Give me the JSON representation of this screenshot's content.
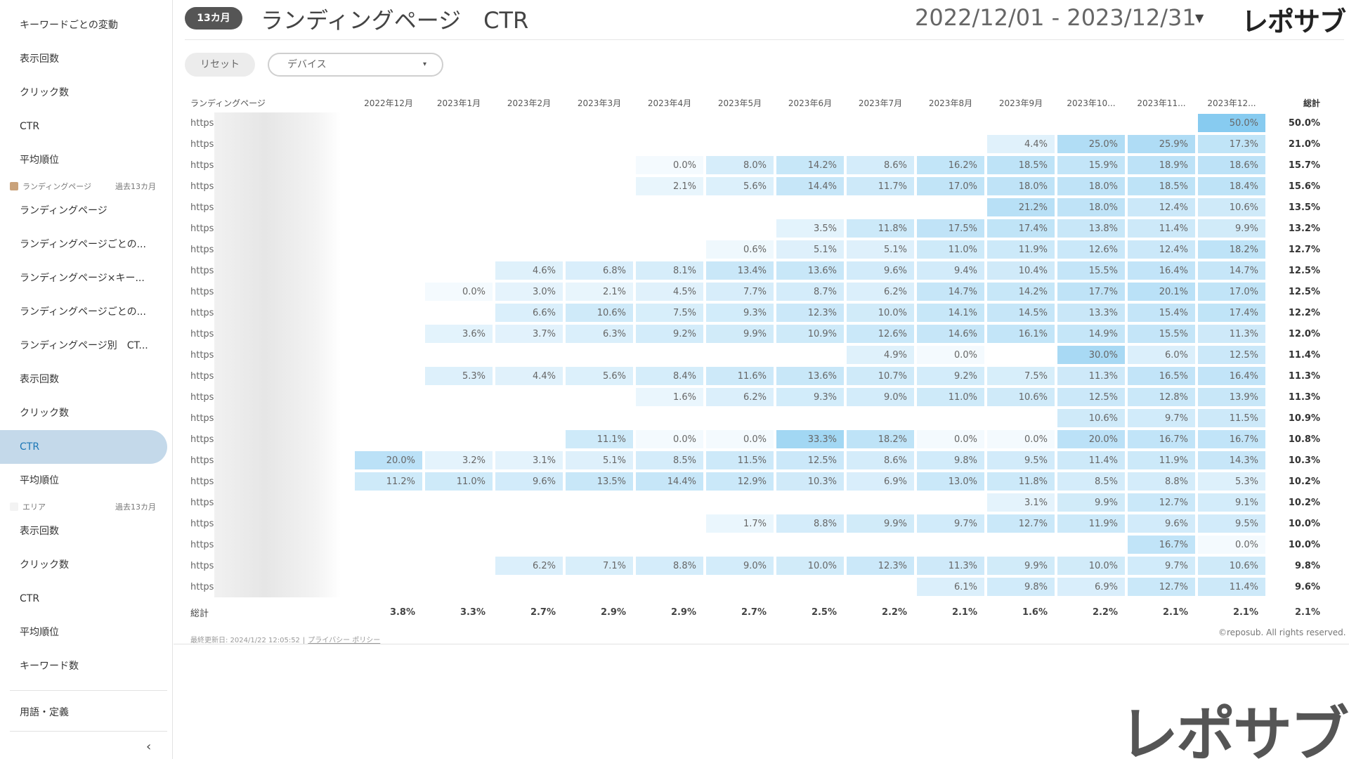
{
  "sidebar": {
    "items_top": [
      {
        "label": "キーワードごとの変動"
      },
      {
        "label": "表示回数"
      },
      {
        "label": "クリック数"
      },
      {
        "label": "CTR"
      },
      {
        "label": "平均順位"
      }
    ],
    "section_lp": {
      "label": "ランディングページ",
      "period": "過去13カ月"
    },
    "items_lp": [
      {
        "label": "ランディングページ"
      },
      {
        "label": "ランディングページごとの..."
      },
      {
        "label": "ランディングページ×キー..."
      },
      {
        "label": "ランディングページごとの..."
      },
      {
        "label": "ランディングページ別　CT..."
      },
      {
        "label": "表示回数"
      },
      {
        "label": "クリック数"
      },
      {
        "label": "CTR"
      },
      {
        "label": "平均順位"
      }
    ],
    "section_area": {
      "label": "エリア",
      "period": "過去13カ月"
    },
    "items_area": [
      {
        "label": "表示回数"
      },
      {
        "label": "クリック数"
      },
      {
        "label": "CTR"
      },
      {
        "label": "平均順位"
      },
      {
        "label": "キーワード数"
      }
    ],
    "glossary": "用語・定義",
    "collapse_icon": "‹"
  },
  "header": {
    "badge": "13カ月",
    "title": "ランディングページ　CTR",
    "date_range": "2022/12/01 - 2023/12/31",
    "caret": "▼",
    "brand": "レポサブ"
  },
  "filters": {
    "reset_label": "リセット",
    "device_label": "デバイス",
    "caret": "▾"
  },
  "table": {
    "lp_header": "ランディングページ",
    "total_header": "総計",
    "months": [
      "2022年12月",
      "2023年1月",
      "2023年2月",
      "2023年3月",
      "2023年4月",
      "2023年5月",
      "2023年6月",
      "2023年7月",
      "2023年8月",
      "2023年9月",
      "2023年10...",
      "2023年11...",
      "2023年12..."
    ],
    "rows": [
      {
        "lp": "https:/",
        "values": [
          null,
          null,
          null,
          null,
          null,
          null,
          null,
          null,
          null,
          null,
          null,
          null,
          50.0
        ],
        "total": "50.0%"
      },
      {
        "lp": "https:/",
        "values": [
          null,
          null,
          null,
          null,
          null,
          null,
          null,
          null,
          null,
          4.4,
          25.0,
          25.9,
          17.3
        ],
        "total": "21.0%"
      },
      {
        "lp": "https:/",
        "values": [
          null,
          null,
          null,
          null,
          0.0,
          8.0,
          14.2,
          8.6,
          16.2,
          18.5,
          15.9,
          18.9,
          18.6
        ],
        "total": "15.7%"
      },
      {
        "lp": "https:/",
        "values": [
          null,
          null,
          null,
          null,
          2.1,
          5.6,
          14.4,
          11.7,
          17.0,
          18.0,
          18.0,
          18.5,
          18.4
        ],
        "total": "15.6%"
      },
      {
        "lp": "https:/",
        "values": [
          null,
          null,
          null,
          null,
          null,
          null,
          null,
          null,
          null,
          21.2,
          18.0,
          12.4,
          10.6
        ],
        "total": "13.5%"
      },
      {
        "lp": "https:/",
        "values": [
          null,
          null,
          null,
          null,
          null,
          null,
          3.5,
          11.8,
          17.5,
          17.4,
          13.8,
          11.4,
          9.9
        ],
        "total": "13.2%"
      },
      {
        "lp": "https:/",
        "values": [
          null,
          null,
          null,
          null,
          null,
          0.6,
          5.1,
          5.1,
          11.0,
          11.9,
          12.6,
          12.4,
          18.2
        ],
        "total": "12.7%"
      },
      {
        "lp": "https:/",
        "values": [
          null,
          null,
          4.6,
          6.8,
          8.1,
          13.4,
          13.6,
          9.6,
          9.4,
          10.4,
          15.5,
          16.4,
          14.7
        ],
        "total": "12.5%"
      },
      {
        "lp": "https:/",
        "values": [
          null,
          0.0,
          3.0,
          2.1,
          4.5,
          7.7,
          8.7,
          6.2,
          14.7,
          14.2,
          17.7,
          20.1,
          17.0
        ],
        "total": "12.5%"
      },
      {
        "lp": "https:/",
        "values": [
          null,
          null,
          6.6,
          10.6,
          7.5,
          9.3,
          12.3,
          10.0,
          14.1,
          14.5,
          13.3,
          15.4,
          17.4
        ],
        "total": "12.2%"
      },
      {
        "lp": "https:/",
        "values": [
          null,
          3.6,
          3.7,
          6.3,
          9.2,
          9.9,
          10.9,
          12.6,
          14.6,
          16.1,
          14.9,
          15.5,
          11.3
        ],
        "total": "12.0%"
      },
      {
        "lp": "https:/",
        "values": [
          null,
          null,
          null,
          null,
          null,
          null,
          null,
          4.9,
          0.0,
          null,
          30.0,
          6.0,
          12.5
        ],
        "total": "11.4%"
      },
      {
        "lp": "https:/",
        "values": [
          null,
          5.3,
          4.4,
          5.6,
          8.4,
          11.6,
          13.6,
          10.7,
          9.2,
          7.5,
          11.3,
          16.5,
          16.4
        ],
        "total": "11.3%"
      },
      {
        "lp": "https:/",
        "values": [
          null,
          null,
          null,
          null,
          1.6,
          6.2,
          9.3,
          9.0,
          11.0,
          10.6,
          12.5,
          12.8,
          13.9
        ],
        "total": "11.3%"
      },
      {
        "lp": "https:/",
        "values": [
          null,
          null,
          null,
          null,
          null,
          null,
          null,
          null,
          null,
          null,
          10.6,
          9.7,
          11.5
        ],
        "total": "10.9%"
      },
      {
        "lp": "https:/",
        "values": [
          null,
          null,
          null,
          11.1,
          0.0,
          0.0,
          33.3,
          18.2,
          0.0,
          0.0,
          20.0,
          16.7,
          16.7
        ],
        "total": "10.8%"
      },
      {
        "lp": "https:/",
        "values": [
          20.0,
          3.2,
          3.1,
          5.1,
          8.5,
          11.5,
          12.5,
          8.6,
          9.8,
          9.5,
          11.4,
          11.9,
          14.3
        ],
        "total": "10.3%"
      },
      {
        "lp": "https:/",
        "values": [
          11.2,
          11.0,
          9.6,
          13.5,
          14.4,
          12.9,
          10.3,
          6.9,
          13.0,
          11.8,
          8.5,
          8.8,
          5.3
        ],
        "total": "10.2%"
      },
      {
        "lp": "https:/",
        "values": [
          null,
          null,
          null,
          null,
          null,
          null,
          null,
          null,
          null,
          3.1,
          9.9,
          12.7,
          9.1
        ],
        "total": "10.2%"
      },
      {
        "lp": "https:/",
        "values": [
          null,
          null,
          null,
          null,
          null,
          1.7,
          8.8,
          9.9,
          9.7,
          12.7,
          11.9,
          9.6,
          9.5
        ],
        "total": "10.0%"
      },
      {
        "lp": "https:/",
        "values": [
          null,
          null,
          null,
          null,
          null,
          null,
          null,
          null,
          null,
          null,
          null,
          16.7,
          0.0
        ],
        "total": "10.0%"
      },
      {
        "lp": "https:/",
        "values": [
          null,
          null,
          6.2,
          7.1,
          8.8,
          9.0,
          10.0,
          12.3,
          11.3,
          9.9,
          10.0,
          9.7,
          10.6
        ],
        "total": "9.8%"
      },
      {
        "lp": "https:/",
        "values": [
          null,
          null,
          null,
          null,
          null,
          null,
          null,
          null,
          6.1,
          9.8,
          6.9,
          12.7,
          11.4
        ],
        "total": "9.6%"
      }
    ],
    "summary": {
      "label": "総計",
      "values": [
        "3.8%",
        "3.3%",
        "2.7%",
        "2.9%",
        "2.9%",
        "2.7%",
        "2.5%",
        "2.2%",
        "2.1%",
        "1.6%",
        "2.2%",
        "2.1%",
        "2.1%"
      ],
      "total": "2.1%"
    }
  },
  "footer": {
    "updated": "最終更新日: 2024/1/22 12:05:52",
    "separator": "|",
    "privacy": "プライバシー ポリシー",
    "copyright": "©reposub. All rights reserved."
  },
  "brand_bottom": "レポサブ",
  "colors": {
    "active_bg": "#c4d9ea",
    "active_text": "#1d77b6",
    "heat_base": "#ffffff",
    "heat_max": "#87cbf0"
  }
}
